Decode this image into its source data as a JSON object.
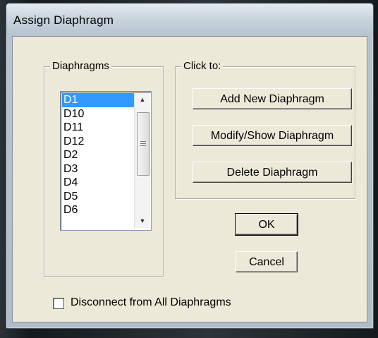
{
  "window": {
    "title": "Assign Diaphragm"
  },
  "diaphragms_group": {
    "label": "Diaphragms",
    "items": [
      "D1",
      "D10",
      "D11",
      "D12",
      "D2",
      "D3",
      "D4",
      "D5",
      "D6"
    ],
    "selected": "D1"
  },
  "actions_group": {
    "label": "Click to:",
    "add_label": "Add New Diaphragm",
    "modify_label": "Modify/Show Diaphragm",
    "delete_label": "Delete Diaphragm"
  },
  "buttons": {
    "ok_label": "OK",
    "cancel_label": "Cancel"
  },
  "checkbox": {
    "label": "Disconnect from All Diaphragms",
    "checked": false
  },
  "icons": {
    "scroll_up": "scroll-up-arrow-icon",
    "scroll_down": "scroll-down-arrow-icon",
    "scroll_grip": "scroll-grip-icon"
  }
}
